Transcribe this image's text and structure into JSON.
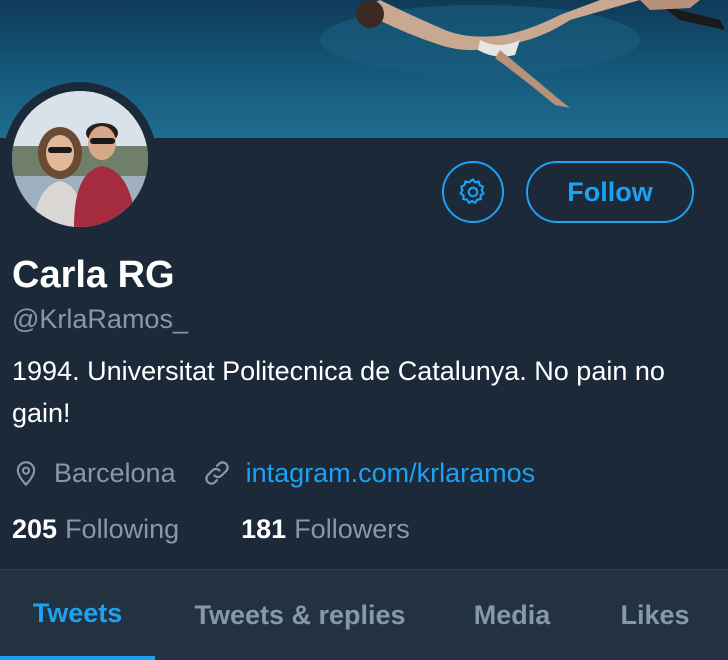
{
  "profile": {
    "name": "Carla RG",
    "handle": "@KrlaRamos_",
    "bio": "1994. Universitat Politecnica de Catalunya. No pain no gain!",
    "location": "Barcelona",
    "website": "intagram.com/krlaramos"
  },
  "actions": {
    "follow_label": "Follow",
    "settings_icon": "gear-icon"
  },
  "stats": {
    "following_count": "205",
    "following_label": "Following",
    "followers_count": "181",
    "followers_label": "Followers"
  },
  "tabs": [
    {
      "label": "Tweets",
      "active": true
    },
    {
      "label": "Tweets & replies",
      "active": false
    },
    {
      "label": "Media",
      "active": false
    },
    {
      "label": "Likes",
      "active": false
    }
  ],
  "colors": {
    "accent": "#1da1f2",
    "background": "#1c2938",
    "secondary_text": "#8899a6"
  }
}
